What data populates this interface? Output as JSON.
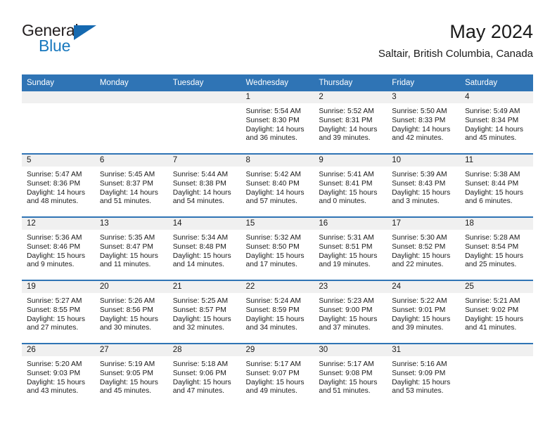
{
  "brand": {
    "name_part1": "General",
    "name_part2": "Blue",
    "triangle_color": "#1569b0",
    "blue_color": "#1878be"
  },
  "header": {
    "month_title": "May 2024",
    "location": "Saltair, British Columbia, Canada",
    "accent_color": "#2f74b5",
    "band_color": "#f0f0f0"
  },
  "weekday_headers": [
    "Sunday",
    "Monday",
    "Tuesday",
    "Wednesday",
    "Thursday",
    "Friday",
    "Saturday"
  ],
  "labels": {
    "sunrise_prefix": "Sunrise:",
    "sunset_prefix": "Sunset:",
    "daylight_prefix": "Daylight:"
  },
  "weeks": [
    [
      {
        "day": "",
        "empty": true
      },
      {
        "day": "",
        "empty": true
      },
      {
        "day": "",
        "empty": true
      },
      {
        "day": "1",
        "sunrise": "Sunrise: 5:54 AM",
        "sunset": "Sunset: 8:30 PM",
        "daylight_line1": "Daylight: 14 hours",
        "daylight_line2": "and 36 minutes."
      },
      {
        "day": "2",
        "sunrise": "Sunrise: 5:52 AM",
        "sunset": "Sunset: 8:31 PM",
        "daylight_line1": "Daylight: 14 hours",
        "daylight_line2": "and 39 minutes."
      },
      {
        "day": "3",
        "sunrise": "Sunrise: 5:50 AM",
        "sunset": "Sunset: 8:33 PM",
        "daylight_line1": "Daylight: 14 hours",
        "daylight_line2": "and 42 minutes."
      },
      {
        "day": "4",
        "sunrise": "Sunrise: 5:49 AM",
        "sunset": "Sunset: 8:34 PM",
        "daylight_line1": "Daylight: 14 hours",
        "daylight_line2": "and 45 minutes."
      }
    ],
    [
      {
        "day": "5",
        "sunrise": "Sunrise: 5:47 AM",
        "sunset": "Sunset: 8:36 PM",
        "daylight_line1": "Daylight: 14 hours",
        "daylight_line2": "and 48 minutes."
      },
      {
        "day": "6",
        "sunrise": "Sunrise: 5:45 AM",
        "sunset": "Sunset: 8:37 PM",
        "daylight_line1": "Daylight: 14 hours",
        "daylight_line2": "and 51 minutes."
      },
      {
        "day": "7",
        "sunrise": "Sunrise: 5:44 AM",
        "sunset": "Sunset: 8:38 PM",
        "daylight_line1": "Daylight: 14 hours",
        "daylight_line2": "and 54 minutes."
      },
      {
        "day": "8",
        "sunrise": "Sunrise: 5:42 AM",
        "sunset": "Sunset: 8:40 PM",
        "daylight_line1": "Daylight: 14 hours",
        "daylight_line2": "and 57 minutes."
      },
      {
        "day": "9",
        "sunrise": "Sunrise: 5:41 AM",
        "sunset": "Sunset: 8:41 PM",
        "daylight_line1": "Daylight: 15 hours",
        "daylight_line2": "and 0 minutes."
      },
      {
        "day": "10",
        "sunrise": "Sunrise: 5:39 AM",
        "sunset": "Sunset: 8:43 PM",
        "daylight_line1": "Daylight: 15 hours",
        "daylight_line2": "and 3 minutes."
      },
      {
        "day": "11",
        "sunrise": "Sunrise: 5:38 AM",
        "sunset": "Sunset: 8:44 PM",
        "daylight_line1": "Daylight: 15 hours",
        "daylight_line2": "and 6 minutes."
      }
    ],
    [
      {
        "day": "12",
        "sunrise": "Sunrise: 5:36 AM",
        "sunset": "Sunset: 8:46 PM",
        "daylight_line1": "Daylight: 15 hours",
        "daylight_line2": "and 9 minutes."
      },
      {
        "day": "13",
        "sunrise": "Sunrise: 5:35 AM",
        "sunset": "Sunset: 8:47 PM",
        "daylight_line1": "Daylight: 15 hours",
        "daylight_line2": "and 11 minutes."
      },
      {
        "day": "14",
        "sunrise": "Sunrise: 5:34 AM",
        "sunset": "Sunset: 8:48 PM",
        "daylight_line1": "Daylight: 15 hours",
        "daylight_line2": "and 14 minutes."
      },
      {
        "day": "15",
        "sunrise": "Sunrise: 5:32 AM",
        "sunset": "Sunset: 8:50 PM",
        "daylight_line1": "Daylight: 15 hours",
        "daylight_line2": "and 17 minutes."
      },
      {
        "day": "16",
        "sunrise": "Sunrise: 5:31 AM",
        "sunset": "Sunset: 8:51 PM",
        "daylight_line1": "Daylight: 15 hours",
        "daylight_line2": "and 19 minutes."
      },
      {
        "day": "17",
        "sunrise": "Sunrise: 5:30 AM",
        "sunset": "Sunset: 8:52 PM",
        "daylight_line1": "Daylight: 15 hours",
        "daylight_line2": "and 22 minutes."
      },
      {
        "day": "18",
        "sunrise": "Sunrise: 5:28 AM",
        "sunset": "Sunset: 8:54 PM",
        "daylight_line1": "Daylight: 15 hours",
        "daylight_line2": "and 25 minutes."
      }
    ],
    [
      {
        "day": "19",
        "sunrise": "Sunrise: 5:27 AM",
        "sunset": "Sunset: 8:55 PM",
        "daylight_line1": "Daylight: 15 hours",
        "daylight_line2": "and 27 minutes."
      },
      {
        "day": "20",
        "sunrise": "Sunrise: 5:26 AM",
        "sunset": "Sunset: 8:56 PM",
        "daylight_line1": "Daylight: 15 hours",
        "daylight_line2": "and 30 minutes."
      },
      {
        "day": "21",
        "sunrise": "Sunrise: 5:25 AM",
        "sunset": "Sunset: 8:57 PM",
        "daylight_line1": "Daylight: 15 hours",
        "daylight_line2": "and 32 minutes."
      },
      {
        "day": "22",
        "sunrise": "Sunrise: 5:24 AM",
        "sunset": "Sunset: 8:59 PM",
        "daylight_line1": "Daylight: 15 hours",
        "daylight_line2": "and 34 minutes."
      },
      {
        "day": "23",
        "sunrise": "Sunrise: 5:23 AM",
        "sunset": "Sunset: 9:00 PM",
        "daylight_line1": "Daylight: 15 hours",
        "daylight_line2": "and 37 minutes."
      },
      {
        "day": "24",
        "sunrise": "Sunrise: 5:22 AM",
        "sunset": "Sunset: 9:01 PM",
        "daylight_line1": "Daylight: 15 hours",
        "daylight_line2": "and 39 minutes."
      },
      {
        "day": "25",
        "sunrise": "Sunrise: 5:21 AM",
        "sunset": "Sunset: 9:02 PM",
        "daylight_line1": "Daylight: 15 hours",
        "daylight_line2": "and 41 minutes."
      }
    ],
    [
      {
        "day": "26",
        "sunrise": "Sunrise: 5:20 AM",
        "sunset": "Sunset: 9:03 PM",
        "daylight_line1": "Daylight: 15 hours",
        "daylight_line2": "and 43 minutes."
      },
      {
        "day": "27",
        "sunrise": "Sunrise: 5:19 AM",
        "sunset": "Sunset: 9:05 PM",
        "daylight_line1": "Daylight: 15 hours",
        "daylight_line2": "and 45 minutes."
      },
      {
        "day": "28",
        "sunrise": "Sunrise: 5:18 AM",
        "sunset": "Sunset: 9:06 PM",
        "daylight_line1": "Daylight: 15 hours",
        "daylight_line2": "and 47 minutes."
      },
      {
        "day": "29",
        "sunrise": "Sunrise: 5:17 AM",
        "sunset": "Sunset: 9:07 PM",
        "daylight_line1": "Daylight: 15 hours",
        "daylight_line2": "and 49 minutes."
      },
      {
        "day": "30",
        "sunrise": "Sunrise: 5:17 AM",
        "sunset": "Sunset: 9:08 PM",
        "daylight_line1": "Daylight: 15 hours",
        "daylight_line2": "and 51 minutes."
      },
      {
        "day": "31",
        "sunrise": "Sunrise: 5:16 AM",
        "sunset": "Sunset: 9:09 PM",
        "daylight_line1": "Daylight: 15 hours",
        "daylight_line2": "and 53 minutes."
      },
      {
        "day": "",
        "empty": true
      }
    ]
  ]
}
